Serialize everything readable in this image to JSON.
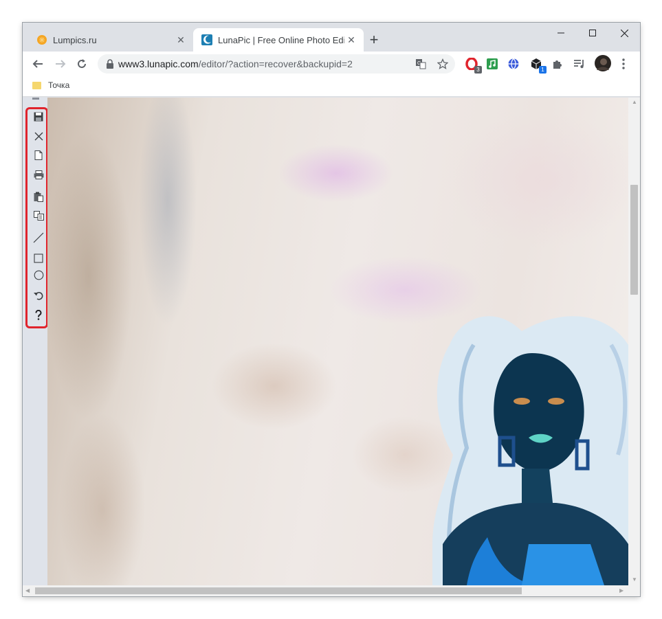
{
  "tabs": [
    {
      "title": "Lumpics.ru",
      "active": false
    },
    {
      "title": "LunaPic | Free Online Photo Editor",
      "active": true
    }
  ],
  "address_bar": {
    "host": "www3.lunapic.com",
    "path": "/editor/?action=recover&backupid=2"
  },
  "extensions": [
    {
      "icon": "opera-icon",
      "badge": "3"
    },
    {
      "icon": "music-note-icon",
      "badge": ""
    },
    {
      "icon": "globe-icon",
      "badge": ""
    },
    {
      "icon": "cube-icon",
      "badge": "1"
    },
    {
      "icon": "puzzle-icon",
      "badge": ""
    },
    {
      "icon": "media-queue-icon",
      "badge": ""
    }
  ],
  "bookmarks": [
    {
      "label": "Точка"
    }
  ],
  "editor_tools": [
    "save-icon",
    "close-icon",
    "new-file-icon",
    "print-icon",
    "paste-icon",
    "copy-icon",
    "line-tool-icon",
    "rectangle-tool-icon",
    "ellipse-tool-icon",
    "undo-icon",
    "help-icon"
  ],
  "colors": {
    "highlight": "#e0242d",
    "chrome_frame": "#dee1e6",
    "sidebar": "#dfe3ea"
  }
}
